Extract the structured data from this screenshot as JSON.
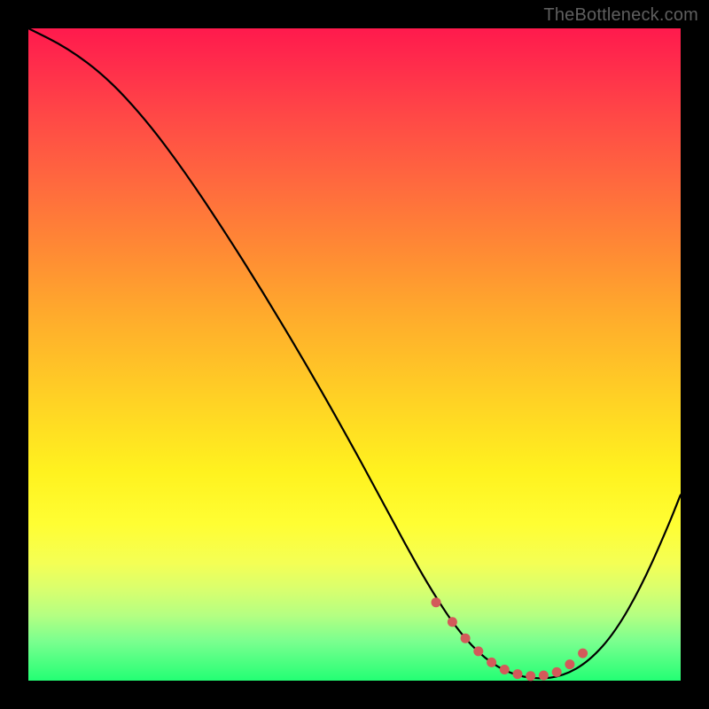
{
  "watermark": "TheBottleneck.com",
  "chart_data": {
    "type": "line",
    "title": "",
    "xlabel": "",
    "ylabel": "",
    "xlim": [
      0,
      100
    ],
    "ylim": [
      0,
      100
    ],
    "grid": false,
    "series": [
      {
        "name": "curve",
        "x": [
          0,
          6,
          12,
          18,
          24,
          30,
          36,
          42,
          48,
          54,
          58,
          62,
          66,
          70,
          74,
          78,
          82,
          86,
          90,
          94,
          98,
          100
        ],
        "y": [
          100,
          97,
          92.5,
          86,
          78,
          69,
          59.5,
          49.5,
          39,
          28,
          20.5,
          13.5,
          7.5,
          3.3,
          1.0,
          0.2,
          0.7,
          3.0,
          7.5,
          14.5,
          23.5,
          28.5
        ],
        "note": "percent of range; y=0 is bottom, y=100 is top"
      }
    ],
    "markers": {
      "name": "bottom-markers",
      "x": [
        62.5,
        65,
        67,
        69,
        71,
        73,
        75,
        77,
        79,
        81,
        83,
        85
      ],
      "y": [
        12,
        9,
        6.5,
        4.5,
        2.8,
        1.7,
        1.0,
        0.7,
        0.8,
        1.3,
        2.5,
        4.2
      ],
      "color": "#d35a5a"
    },
    "background_gradient": [
      "#ff1a4d",
      "#ff8a34",
      "#fff21f",
      "#23ff74"
    ]
  }
}
